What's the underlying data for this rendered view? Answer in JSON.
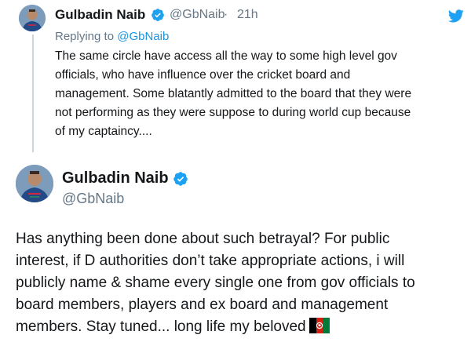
{
  "reply_tweet": {
    "author_name": "Gulbadin Naib",
    "author_handle": "@GbNaib",
    "separator": "·",
    "time": "21h",
    "replying_label": "Replying to",
    "replying_handle": "@GbNaib",
    "text_lines": [
      "The same circle have access all the way to some high level gov",
      "officials, who have influence over the cricket board and",
      "management. Some blatantly admitted to the board that they were",
      "not performing as they were suppose to during world cup because",
      "of my captaincy...."
    ]
  },
  "main_tweet": {
    "author_name": "Gulbadin Naib",
    "author_handle": "@GbNaib",
    "text_lines": [
      "Has anything been done about such betrayal? For public",
      "interest, if D authorities don’t take appropriate actions, i will",
      "publicly name & shame every single one from gov officials to",
      "board members, players and ex board and management",
      "members. Stay tuned... long life my beloved"
    ],
    "trailing_emoji": "afghanistan-flag-emoji"
  },
  "icons": {
    "verified": "verified-badge-icon",
    "platform": "twitter-bird-icon"
  },
  "colors": {
    "accent": "#1da1f2",
    "secondary_text": "#657786",
    "mention": "#1b95e0",
    "thread_line": "#ccd6dd"
  }
}
